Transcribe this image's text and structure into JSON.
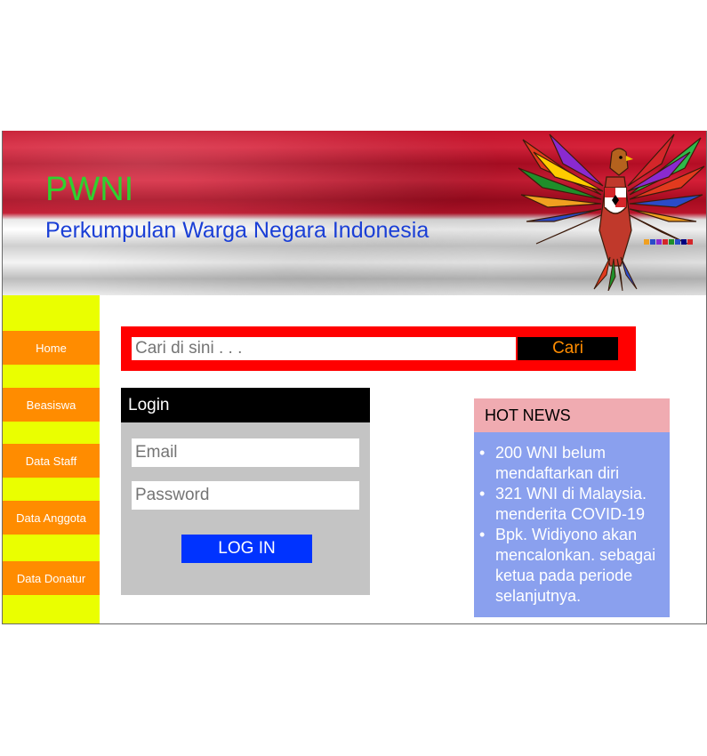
{
  "header": {
    "title": "PWNI",
    "subtitle": "Perkumpulan Warga Negara Indonesia",
    "logo_icon": "garuda-emblem-icon"
  },
  "sidebar": {
    "items": [
      {
        "label": "Home"
      },
      {
        "label": "Beasiswa"
      },
      {
        "label": "Data Staff"
      },
      {
        "label": "Data Anggota"
      },
      {
        "label": "Data Donatur"
      }
    ]
  },
  "search": {
    "placeholder": "Cari di sini . . .",
    "button_label": "Cari"
  },
  "login": {
    "title": "Login",
    "email_placeholder": "Email",
    "password_placeholder": "Password",
    "button_label": "LOG IN"
  },
  "news": {
    "title": "HOT NEWS",
    "items": [
      {
        "text": "200 WNI belum mendaftarkan diri"
      },
      {
        "text": "321 WNI di Malaysia. menderita COVID-19"
      },
      {
        "text": "Bpk. Widiyono akan mencalonkan. sebagai ketua pada periode selanjutnya."
      }
    ]
  },
  "colors": {
    "sidebar_bg": "#eaff00",
    "nav_item_bg": "#ff8c00",
    "search_frame": "#ff0000",
    "login_button": "#0033ff",
    "news_header": "#f0abb1",
    "news_body": "#8aa0ee"
  }
}
